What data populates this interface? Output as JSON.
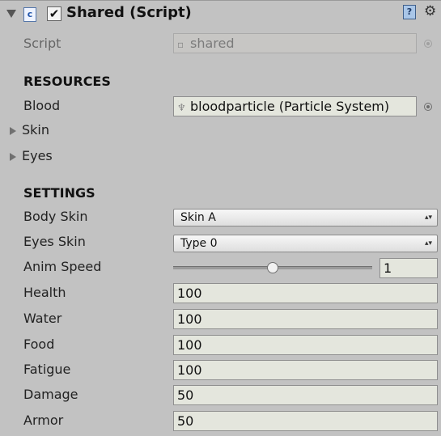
{
  "component": {
    "title": "Shared (Script)",
    "enabled_mark": "✔",
    "foldout_state": "expanded",
    "icons": {
      "script": "script-icon",
      "help": "help-icon",
      "settings": "gear-icon",
      "fold": "triangle-down-icon"
    }
  },
  "script_field": {
    "label": "Script",
    "value": "shared"
  },
  "resources": {
    "title": "RESOURCES",
    "blood": {
      "label": "Blood",
      "value": "bloodparticle (Particle System)"
    },
    "skin_foldout": "Skin",
    "eyes_foldout": "Eyes"
  },
  "settings": {
    "title": "SETTINGS",
    "body_skin": {
      "label": "Body Skin",
      "value": "Skin A"
    },
    "eyes_skin": {
      "label": "Eyes Skin",
      "value": "Type 0"
    },
    "anim_speed": {
      "label": "Anim Speed",
      "value": "1",
      "slider_fraction": 0.5
    },
    "health": {
      "label": "Health",
      "value": "100"
    },
    "water": {
      "label": "Water",
      "value": "100"
    },
    "food": {
      "label": "Food",
      "value": "100"
    },
    "fatigue": {
      "label": "Fatigue",
      "value": "100"
    },
    "damage": {
      "label": "Damage",
      "value": "50"
    },
    "armor": {
      "label": "Armor",
      "value": "50"
    }
  },
  "colors": {
    "panel_background": "#c2c2c2",
    "field_background": "#e4e6dd"
  }
}
